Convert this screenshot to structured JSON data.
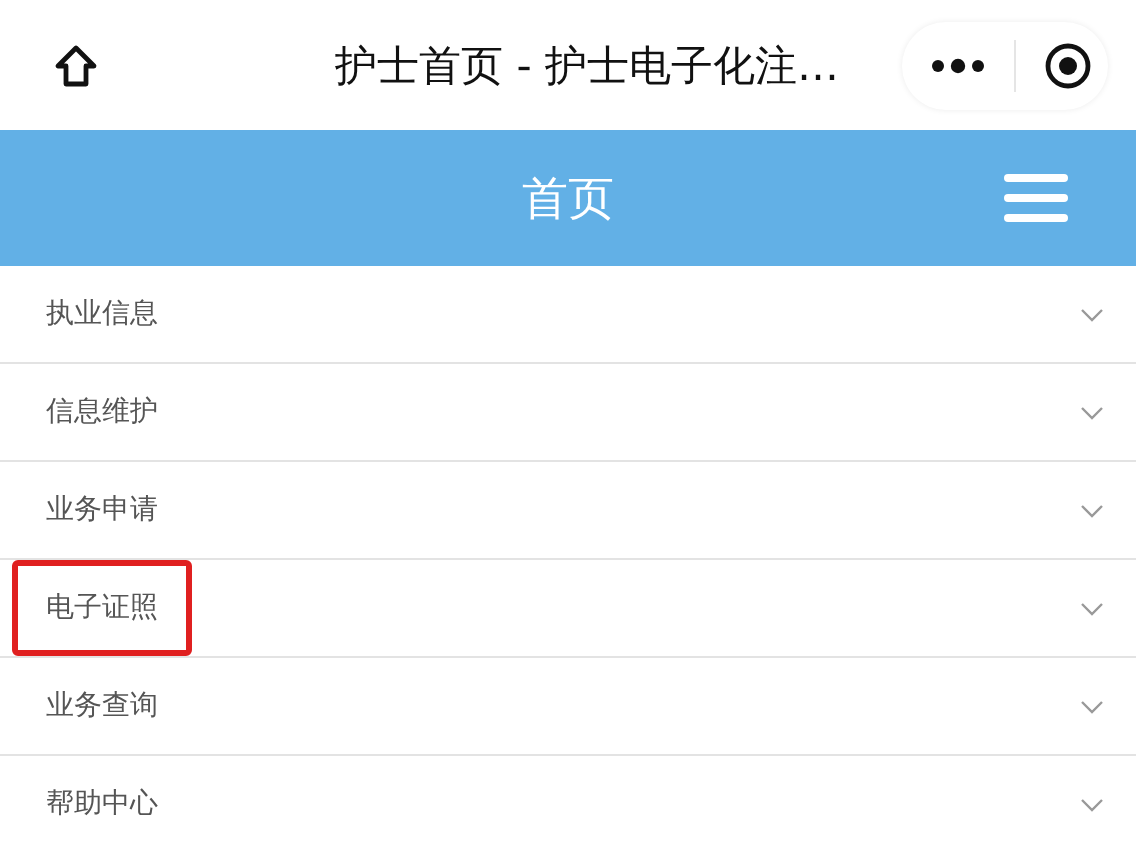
{
  "window": {
    "title": "护士首页 - 护士电子化注…"
  },
  "header": {
    "title": "首页"
  },
  "menu_items": [
    {
      "label": "执业信息",
      "highlighted": false
    },
    {
      "label": "信息维护",
      "highlighted": false
    },
    {
      "label": "业务申请",
      "highlighted": false
    },
    {
      "label": "电子证照",
      "highlighted": true
    },
    {
      "label": "业务查询",
      "highlighted": false
    },
    {
      "label": "帮助中心",
      "highlighted": false
    }
  ]
}
